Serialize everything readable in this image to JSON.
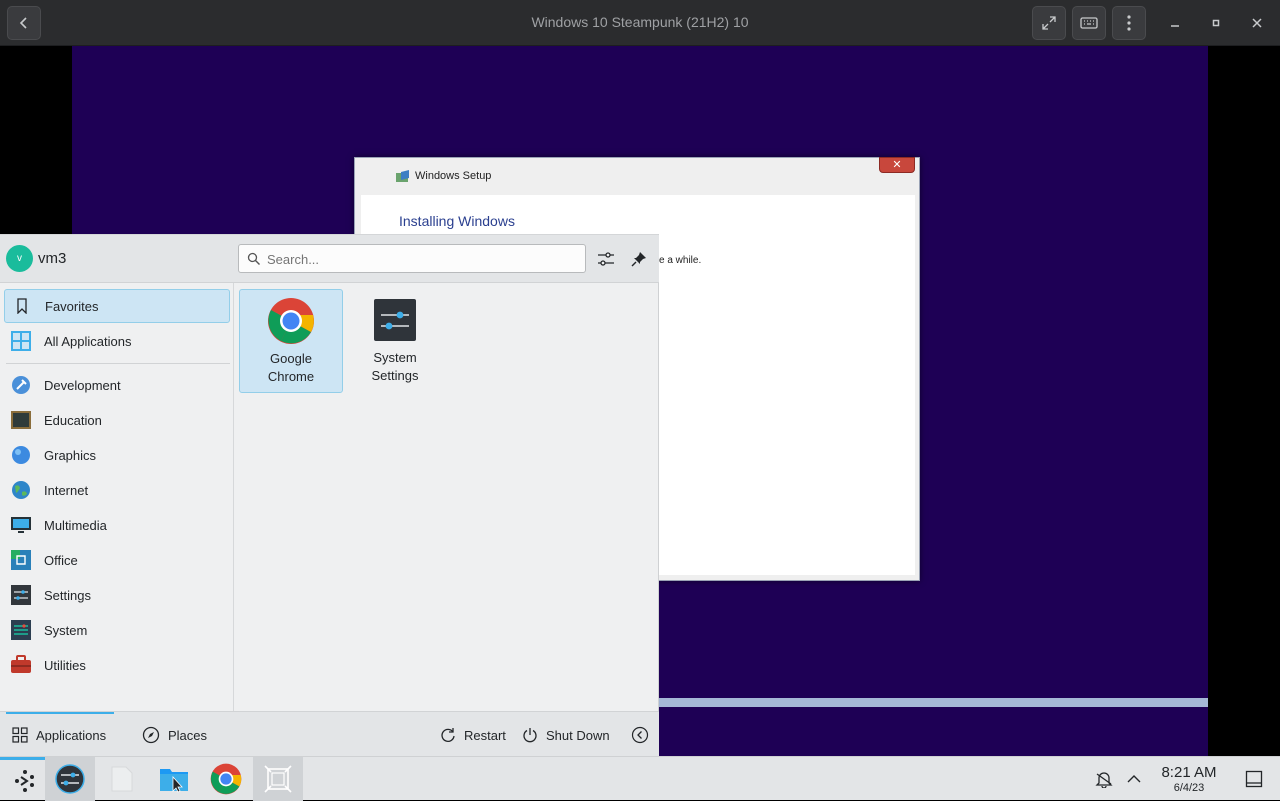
{
  "window": {
    "title": "Windows 10 Steampunk (21H2) 10",
    "icons": [
      "back-icon",
      "fullscreen-icon",
      "keyboard-icon",
      "kebab-menu-icon",
      "minimize-icon",
      "maximize-icon",
      "close-icon"
    ]
  },
  "setup": {
    "title": "Windows Setup",
    "heading": "Installing Windows",
    "partial_text": "e a while."
  },
  "launcher": {
    "user": {
      "initial": "v",
      "name": "vm3"
    },
    "search": {
      "placeholder": "Search...",
      "value": ""
    },
    "categories": [
      {
        "label": "Favorites",
        "icon": "bookmark-icon",
        "selected": true
      },
      {
        "label": "All Applications",
        "icon": "grid-icon"
      },
      {
        "label": "Development",
        "icon": "development-icon"
      },
      {
        "label": "Education",
        "icon": "education-icon"
      },
      {
        "label": "Graphics",
        "icon": "graphics-icon"
      },
      {
        "label": "Internet",
        "icon": "globe-icon"
      },
      {
        "label": "Multimedia",
        "icon": "multimedia-icon"
      },
      {
        "label": "Office",
        "icon": "office-icon"
      },
      {
        "label": "Settings",
        "icon": "settings-icon"
      },
      {
        "label": "System",
        "icon": "system-icon"
      },
      {
        "label": "Utilities",
        "icon": "toolbox-icon"
      }
    ],
    "favorites": [
      {
        "line1": "Google",
        "line2": "Chrome",
        "icon": "chrome-icon",
        "selected": true
      },
      {
        "line1": "System",
        "line2": "Settings",
        "icon": "system-settings-icon"
      }
    ],
    "footer": {
      "applications": "Applications",
      "places": "Places",
      "restart": "Restart",
      "shutdown": "Shut Down"
    }
  },
  "taskbar": {
    "time": "8:21 AM",
    "date": "6/4/23",
    "icons": [
      "kde-menu-icon",
      "system-settings-icon",
      "files-icon",
      "file-manager-icon",
      "chrome-icon",
      "virt-viewer-icon",
      "notification-bell-icon",
      "tray-expand-icon",
      "show-desktop-icon"
    ]
  },
  "colors": {
    "vm_background": "#1e0055",
    "accent": "#3daee9",
    "selection": "#cde5f4"
  }
}
